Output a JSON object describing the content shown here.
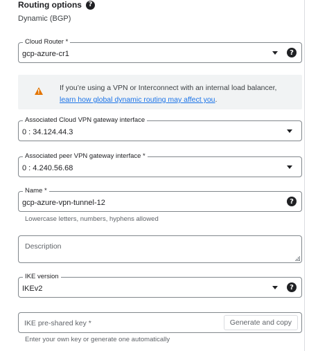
{
  "routing": {
    "title": "Routing options",
    "value": "Dynamic (BGP)"
  },
  "cloud_router": {
    "label": "Cloud Router *",
    "value": "gcp-azure-cr1"
  },
  "warning": {
    "text": "If you’re using a VPN or Interconnect with an internal load balancer,",
    "link": "learn how global dynamic routing may affect you",
    "suffix": "."
  },
  "cloud_vpn_interface": {
    "label": "Associated Cloud VPN gateway interface",
    "value": "0 : 34.124.44.3"
  },
  "peer_vpn_interface": {
    "label": "Associated peer VPN gateway interface *",
    "value": "0 : 4.240.56.68"
  },
  "name": {
    "label": "Name *",
    "value": "gcp-azure-vpn-tunnel-12",
    "hint": "Lowercase letters, numbers, hyphens allowed"
  },
  "description": {
    "placeholder": "Description"
  },
  "ike_version": {
    "label": "IKE version",
    "value": "IKEv2"
  },
  "ike_key": {
    "placeholder": "IKE pre-shared key *",
    "button": "Generate and copy",
    "hint": "Enter your own key or generate one automatically"
  },
  "icons": {
    "help": "?",
    "warning": "!"
  }
}
